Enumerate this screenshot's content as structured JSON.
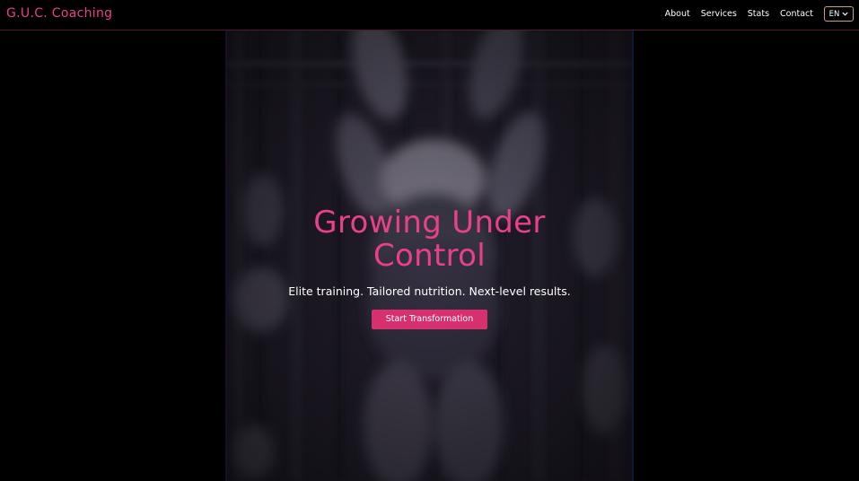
{
  "navbar": {
    "brand": "G.U.C. Coaching",
    "links": [
      "About",
      "Services",
      "Stats",
      "Contact"
    ],
    "language": "EN"
  },
  "hero": {
    "title": "Growing Under Control",
    "subtitle": "Elite training. Tailored nutrition. Next-level results.",
    "cta_label": "Start Transformation"
  },
  "colors": {
    "accent": "#e8408a",
    "button": "#d6306f",
    "lang_border": "#c9a65e",
    "background": "#000000"
  }
}
